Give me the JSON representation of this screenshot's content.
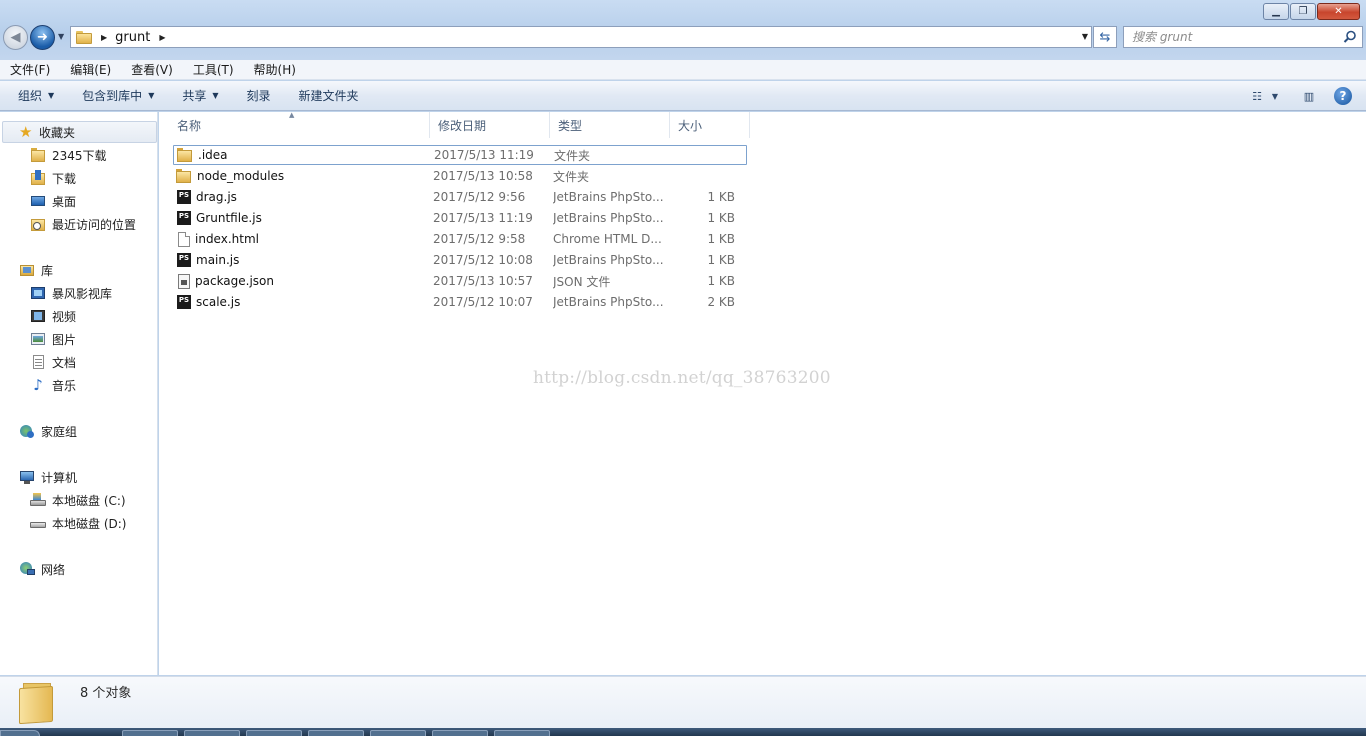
{
  "window": {
    "minimize_label": "▁",
    "maximize_label": "❐",
    "close_label": "✕"
  },
  "address": {
    "crumb": "grunt",
    "search_placeholder": "搜索 grunt"
  },
  "menu": [
    "文件(F)",
    "编辑(E)",
    "查看(V)",
    "工具(T)",
    "帮助(H)"
  ],
  "commands": {
    "organize": "组织",
    "include_in_library": "包含到库中",
    "share": "共享",
    "burn": "刻录",
    "new_folder": "新建文件夹"
  },
  "nav": {
    "favorites": "收藏夹",
    "favorite_items": [
      "2345下载",
      "下载",
      "桌面",
      "最近访问的位置"
    ],
    "libraries": "库",
    "library_items": [
      "暴风影视库",
      "视频",
      "图片",
      "文档",
      "音乐"
    ],
    "homegroup": "家庭组",
    "computer": "计算机",
    "drives": [
      "本地磁盘 (C:)",
      "本地磁盘 (D:)"
    ],
    "network": "网络"
  },
  "columns": {
    "name": "名称",
    "date": "修改日期",
    "type": "类型",
    "size": "大小"
  },
  "files": [
    {
      "name": ".idea",
      "date": "2017/5/13 11:19",
      "type": "文件夹",
      "size": "",
      "icon": "folder-icon"
    },
    {
      "name": "node_modules",
      "date": "2017/5/13 10:58",
      "type": "文件夹",
      "size": "",
      "icon": "folder-icon"
    },
    {
      "name": "drag.js",
      "date": "2017/5/12 9:56",
      "type": "JetBrains PhpSto...",
      "size": "1 KB",
      "icon": "phpstorm-file-icon"
    },
    {
      "name": "Gruntfile.js",
      "date": "2017/5/13 11:19",
      "type": "JetBrains PhpSto...",
      "size": "1 KB",
      "icon": "phpstorm-file-icon"
    },
    {
      "name": "index.html",
      "date": "2017/5/12 9:58",
      "type": "Chrome HTML D...",
      "size": "1 KB",
      "icon": "html-file-icon"
    },
    {
      "name": "main.js",
      "date": "2017/5/12 10:08",
      "type": "JetBrains PhpSto...",
      "size": "1 KB",
      "icon": "phpstorm-file-icon"
    },
    {
      "name": "package.json",
      "date": "2017/5/13 10:57",
      "type": "JSON 文件",
      "size": "1 KB",
      "icon": "json-file-icon"
    },
    {
      "name": "scale.js",
      "date": "2017/5/12 10:07",
      "type": "JetBrains PhpSto...",
      "size": "2 KB",
      "icon": "phpstorm-file-icon"
    }
  ],
  "watermark": "http://blog.csdn.net/qq_38763200",
  "status": {
    "count": "8 个对象"
  },
  "colors": {
    "accent": "#1e395b",
    "selection_border": "#7da2ce"
  }
}
